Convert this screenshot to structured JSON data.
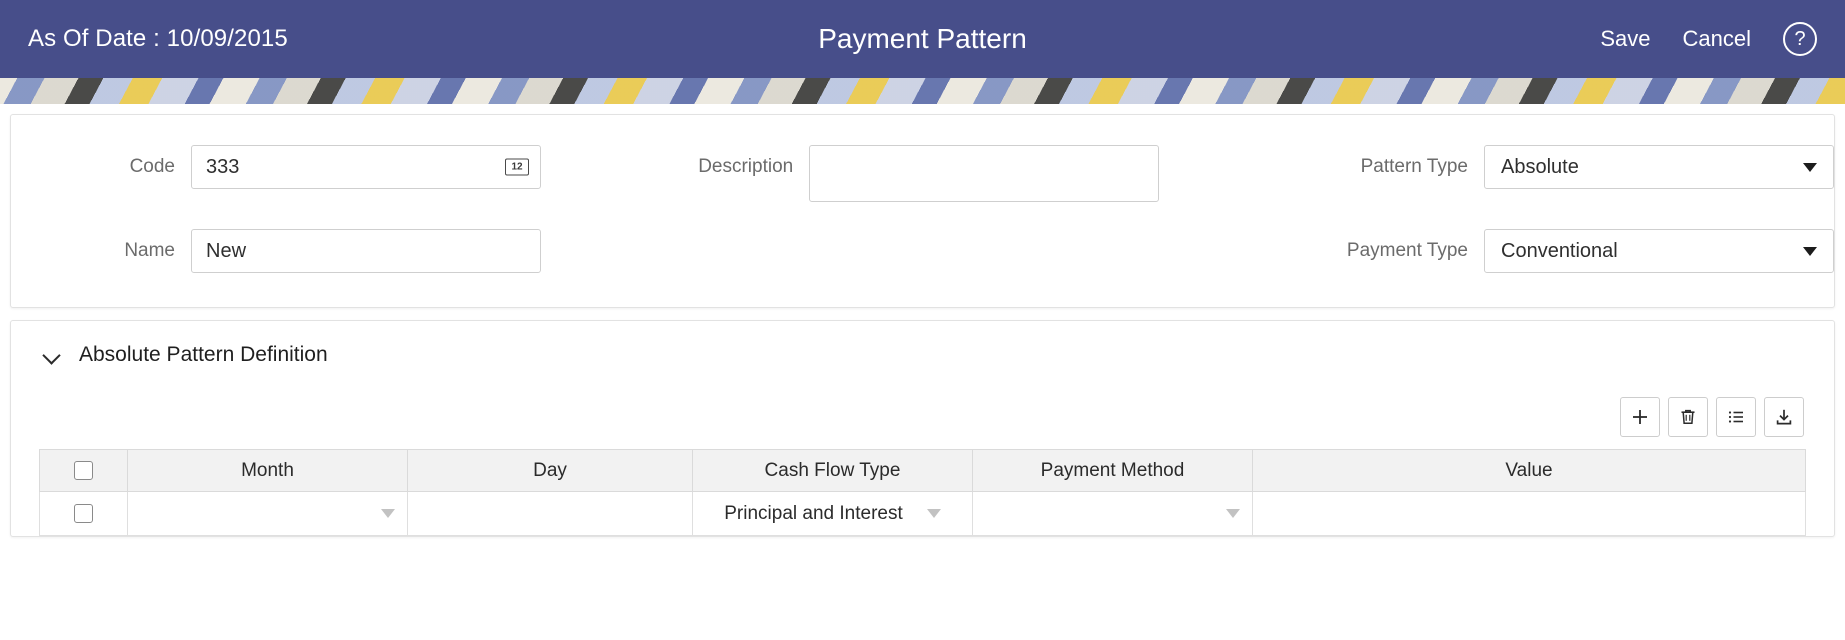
{
  "header": {
    "as_of_date_label": "As Of Date : 10/09/2015",
    "title": "Payment Pattern",
    "save_label": "Save",
    "cancel_label": "Cancel",
    "help_glyph": "?",
    "background_color": "#474e8a"
  },
  "form": {
    "code": {
      "label": "Code",
      "value": "333",
      "placeholder": "",
      "icon_text": "12"
    },
    "name": {
      "label": "Name",
      "value": "New",
      "placeholder": ""
    },
    "description": {
      "label": "Description",
      "value": "",
      "placeholder": ""
    },
    "pattern_type": {
      "label": "Pattern Type",
      "value": "Absolute"
    },
    "payment_type": {
      "label": "Payment Type",
      "value": "Conventional"
    }
  },
  "section": {
    "title": "Absolute Pattern Definition",
    "expanded": true
  },
  "toolbar": {
    "add_label": "add-row",
    "delete_label": "delete-row",
    "list_label": "view-list",
    "download_label": "download"
  },
  "table": {
    "columns": [
      "",
      "Month",
      "Day",
      "Cash Flow Type",
      "Payment Method",
      "Value"
    ],
    "rows": [
      {
        "selected": false,
        "month": "",
        "day": "",
        "cash_flow_type": "Principal and Interest",
        "payment_method": "",
        "value": ""
      }
    ]
  }
}
